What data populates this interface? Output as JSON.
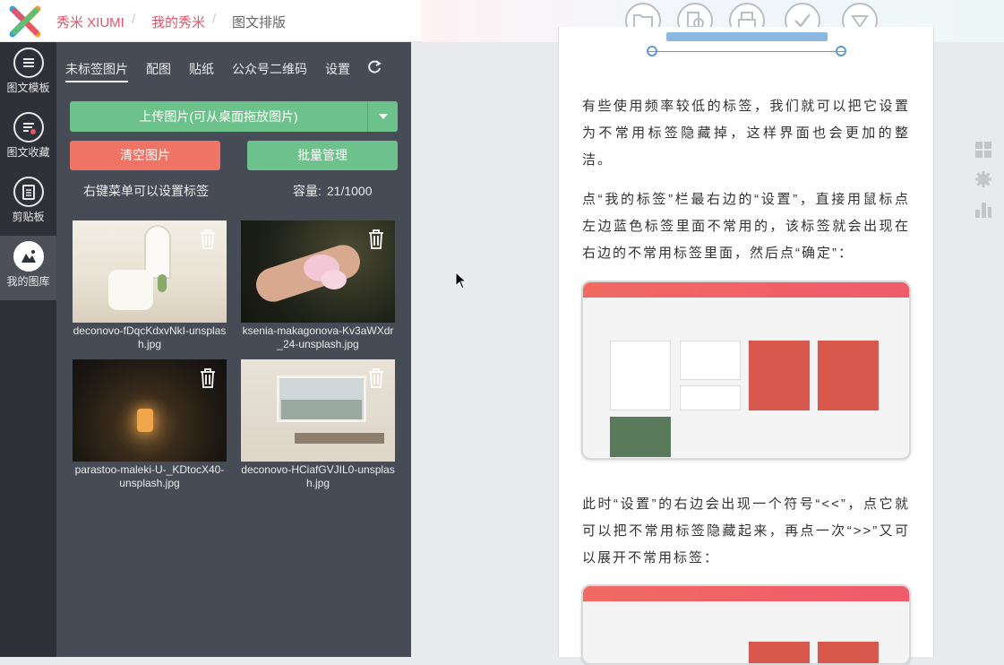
{
  "header": {
    "brand": "秀米 XIUMI",
    "breadcrumbs": [
      "我的秀米",
      "图文排版"
    ]
  },
  "toolbar": {
    "icons": [
      "folder-icon",
      "save-preview-icon",
      "print-icon",
      "check-icon",
      "dropdown-icon"
    ]
  },
  "leftnav": {
    "items": [
      {
        "label": "图文模板",
        "icon": "template-icon"
      },
      {
        "label": "图文收藏",
        "icon": "favorite-icon"
      },
      {
        "label": "剪贴板",
        "icon": "clipboard-icon"
      },
      {
        "label": "我的图库",
        "icon": "gallery-icon"
      }
    ]
  },
  "panel": {
    "tabs": [
      "未标签图片",
      "配图",
      "贴纸",
      "公众号二维码",
      "设置"
    ],
    "upload_label": "上传图片(可从桌面拖放图片)",
    "clear_label": "清空图片",
    "batch_label": "批量管理",
    "hint": "右键菜单可以设置标签",
    "capacity_label": "容量:",
    "capacity_value": "21/1000",
    "images": [
      {
        "name": "deconovo-fDqcKdxvNkI-unsplash.jpg"
      },
      {
        "name": "ksenia-makagonova-Kv3aWXdr_24-unsplash.jpg"
      },
      {
        "name": "parastoo-maleki-U-_KDtocX40-unsplash.jpg"
      },
      {
        "name": "deconovo-HCiafGVJIL0-unsplash.jpg"
      }
    ]
  },
  "doc": {
    "paragraphs": [
      "有些使用频率较低的标签，我们就可以把它设置为不常用标签隐藏掉，这样界面也会更加的整洁。",
      "点“我的标签”栏最右边的“设置”，直接用鼠标点左边蓝色标签里面不常用的，该标签就会出现在右边的不常用标签里面，然后点“确定”：",
      "此时“设置”的右边会出现一个符号“<<”，点它就可以把不常用标签隐藏起来，再点一次“>>”又可以展开不常用标签："
    ]
  },
  "colors": {
    "brand": "#e8546a",
    "green": "#6cc28a",
    "red": "#ef7466",
    "nav": "#2f3138",
    "panel": "#464b55"
  }
}
